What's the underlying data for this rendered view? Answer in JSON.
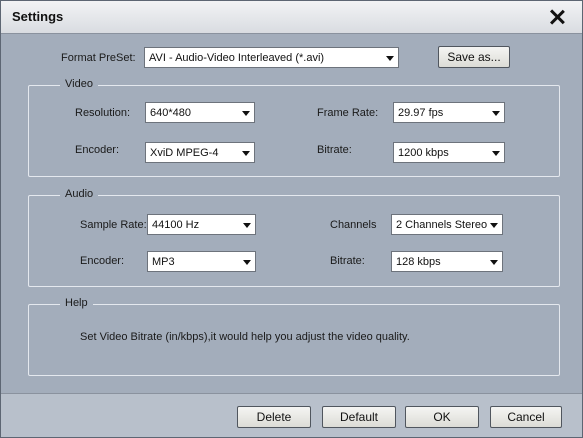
{
  "window": {
    "title": "Settings"
  },
  "preset": {
    "label": "Format PreSet:",
    "value": "AVI - Audio-Video Interleaved (*.avi)",
    "save_as_label": "Save as..."
  },
  "video": {
    "group_label": "Video",
    "resolution": {
      "label": "Resolution:",
      "value": "640*480"
    },
    "frame_rate": {
      "label": "Frame Rate:",
      "value": "29.97 fps"
    },
    "encoder": {
      "label": "Encoder:",
      "value": "XviD MPEG-4"
    },
    "bitrate": {
      "label": "Bitrate:",
      "value": "1200 kbps"
    }
  },
  "audio": {
    "group_label": "Audio",
    "sample_rate": {
      "label": "Sample Rate:",
      "value": "44100 Hz"
    },
    "channels": {
      "label": "Channels",
      "value": "2 Channels Stereo"
    },
    "encoder": {
      "label": "Encoder:",
      "value": "MP3"
    },
    "bitrate": {
      "label": "Bitrate:",
      "value": "128 kbps"
    }
  },
  "help": {
    "group_label": "Help",
    "text": "Set Video Bitrate (in/kbps),it would help you adjust the video quality."
  },
  "buttons": {
    "delete": "Delete",
    "default": "Default",
    "ok": "OK",
    "cancel": "Cancel"
  }
}
